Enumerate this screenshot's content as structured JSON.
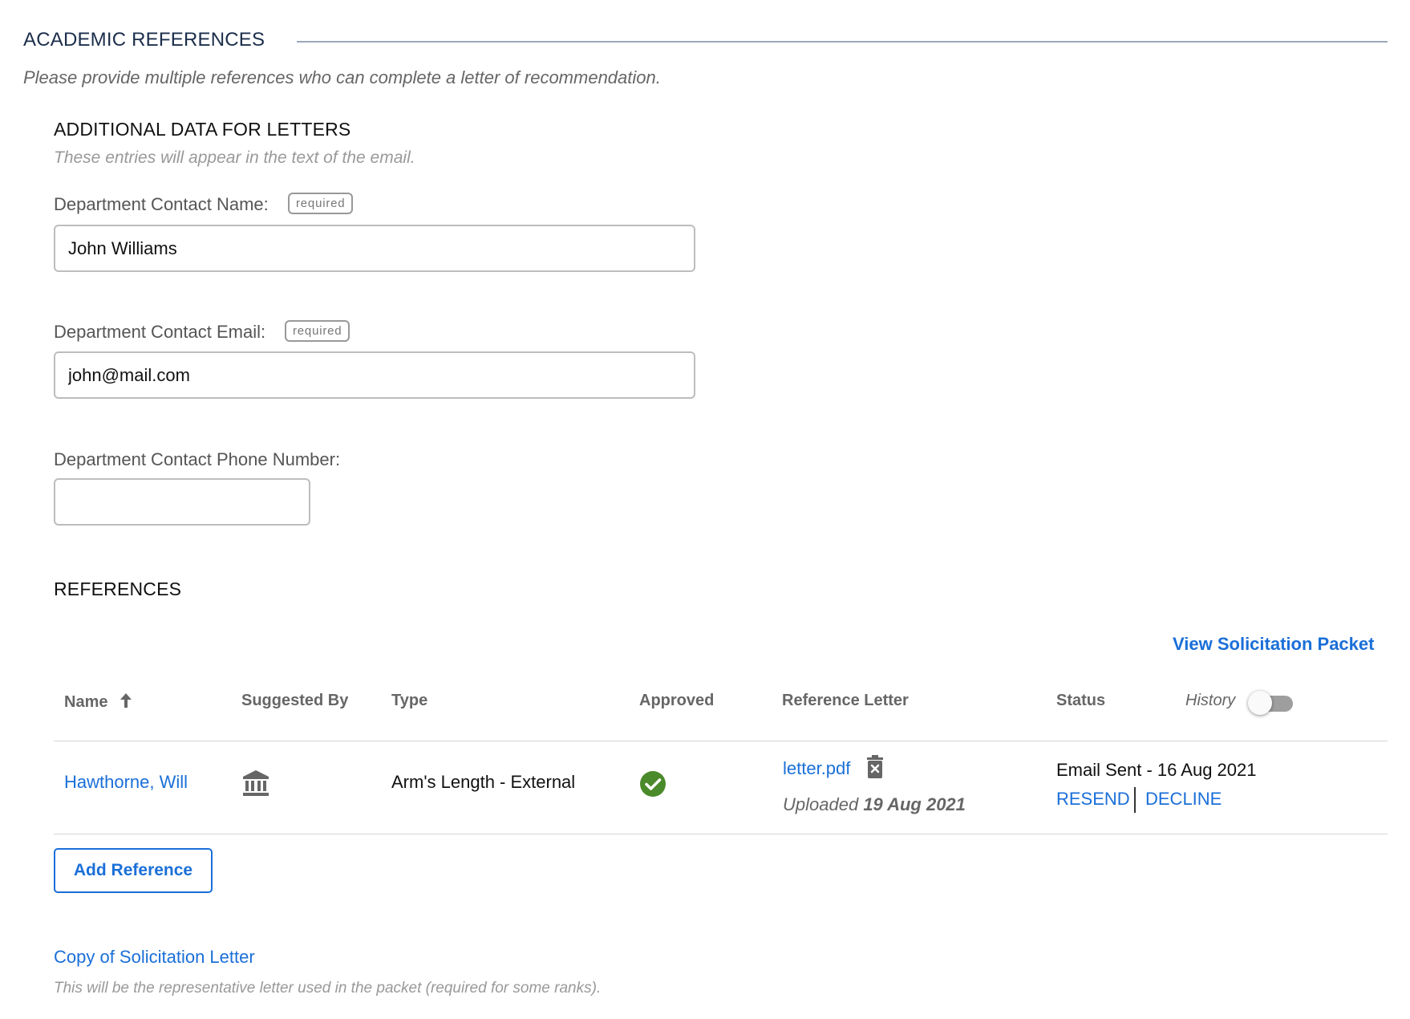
{
  "section": {
    "title": "ACADEMIC REFERENCES",
    "description": "Please provide multiple references who can complete a letter of recommendation."
  },
  "letters_data": {
    "title": "ADDITIONAL DATA FOR LETTERS",
    "description": "These entries will appear in the text of the email.",
    "required_badge": "required",
    "fields": [
      {
        "label": "Department Contact Name:",
        "value": "John Williams",
        "required": true
      },
      {
        "label": "Department Contact Email:",
        "value": "john@mail.com",
        "required": true
      },
      {
        "label": "Department Contact Phone Number:",
        "value": "",
        "required": false
      }
    ]
  },
  "references": {
    "title": "REFERENCES",
    "view_packet_label": "View Solicitation Packet",
    "columns": {
      "name": "Name",
      "suggested_by": "Suggested By",
      "type": "Type",
      "approved": "Approved",
      "reference_letter": "Reference Letter",
      "status": "Status",
      "history": "History"
    },
    "history_toggle_on": false,
    "rows": [
      {
        "name": "Hawthorne, Will",
        "suggested_by_icon": "institution-icon",
        "type": "Arm's Length - External",
        "approved_icon": "check-circle-icon",
        "letter_file": "letter.pdf",
        "uploaded_prefix": "Uploaded",
        "uploaded_date": "19 Aug 2021",
        "status": "Email Sent - 16 Aug 2021",
        "resend_label": "RESEND",
        "decline_label": "DECLINE"
      }
    ],
    "add_button_label": "Add Reference"
  },
  "solicitation": {
    "link_label": "Copy of Solicitation Letter",
    "description": "This will be the representative letter used in the packet (required for some ranks)."
  },
  "colors": {
    "link": "#1a6fd8",
    "heading": "#1b2e4b",
    "approved_green": "#4a8a2a"
  }
}
